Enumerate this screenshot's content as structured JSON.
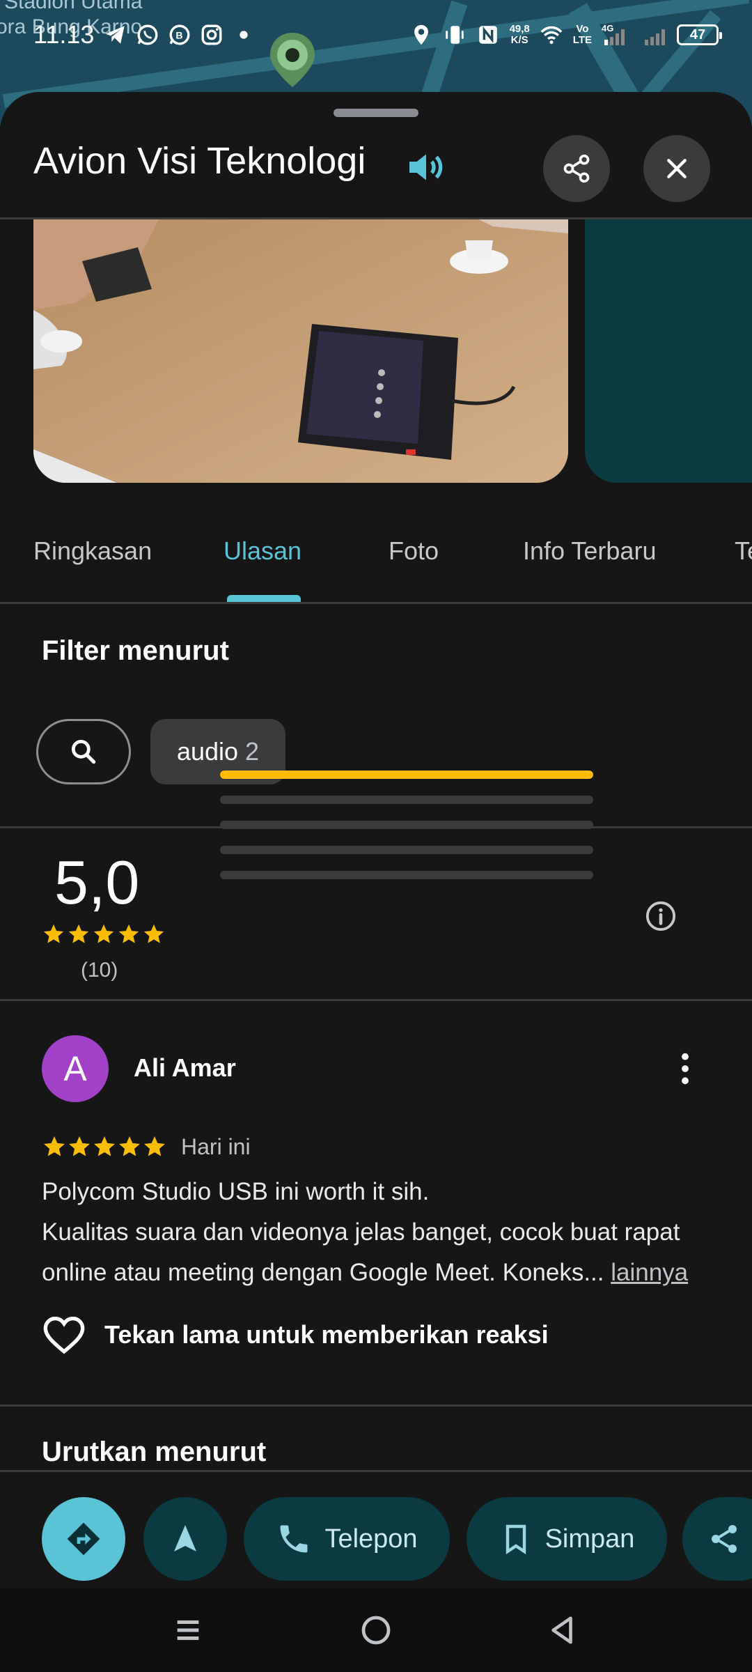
{
  "status_bar": {
    "time": "11.13",
    "net_speed_top": "49,8",
    "net_speed_bottom": "K/S",
    "volte_top": "Vo",
    "volte_bottom": "LTE",
    "network": "4G",
    "battery": "47"
  },
  "map": {
    "label_line1": "Stadion Utama",
    "label_line2": "ora Bung Karno"
  },
  "header": {
    "title": "Avion Visi Teknologi"
  },
  "tabs": [
    {
      "label": "Ringkasan"
    },
    {
      "label": "Ulasan"
    },
    {
      "label": "Foto"
    },
    {
      "label": "Info Terbaru"
    },
    {
      "label": "Te"
    }
  ],
  "filter": {
    "title": "Filter menurut",
    "chip_label": "audio",
    "chip_count": "2"
  },
  "rating": {
    "value": "5,0",
    "count": "(10)",
    "stars": 5,
    "distribution": [
      1.0,
      0,
      0,
      0,
      0
    ]
  },
  "review": {
    "avatar_letter": "A",
    "name": "Ali Amar",
    "stars": 5,
    "date": "Hari ini",
    "line1": "Polycom Studio USB ini worth it sih.",
    "line2": "Kualitas suara dan videonya jelas banget, cocok buat rapat online atau meeting dengan Google Meet. Koneks...",
    "more_link": "lainnya",
    "reaction_hint": "Tekan lama untuk memberikan reaksi"
  },
  "sort": {
    "title": "Urutkan menurut"
  },
  "actions": {
    "call_label": "Telepon",
    "save_label": "Simpan"
  },
  "colors": {
    "accent": "#5bc3d6",
    "star": "#fbbc04",
    "avatar": "#a142c9",
    "action_bg": "#0b3a41"
  }
}
